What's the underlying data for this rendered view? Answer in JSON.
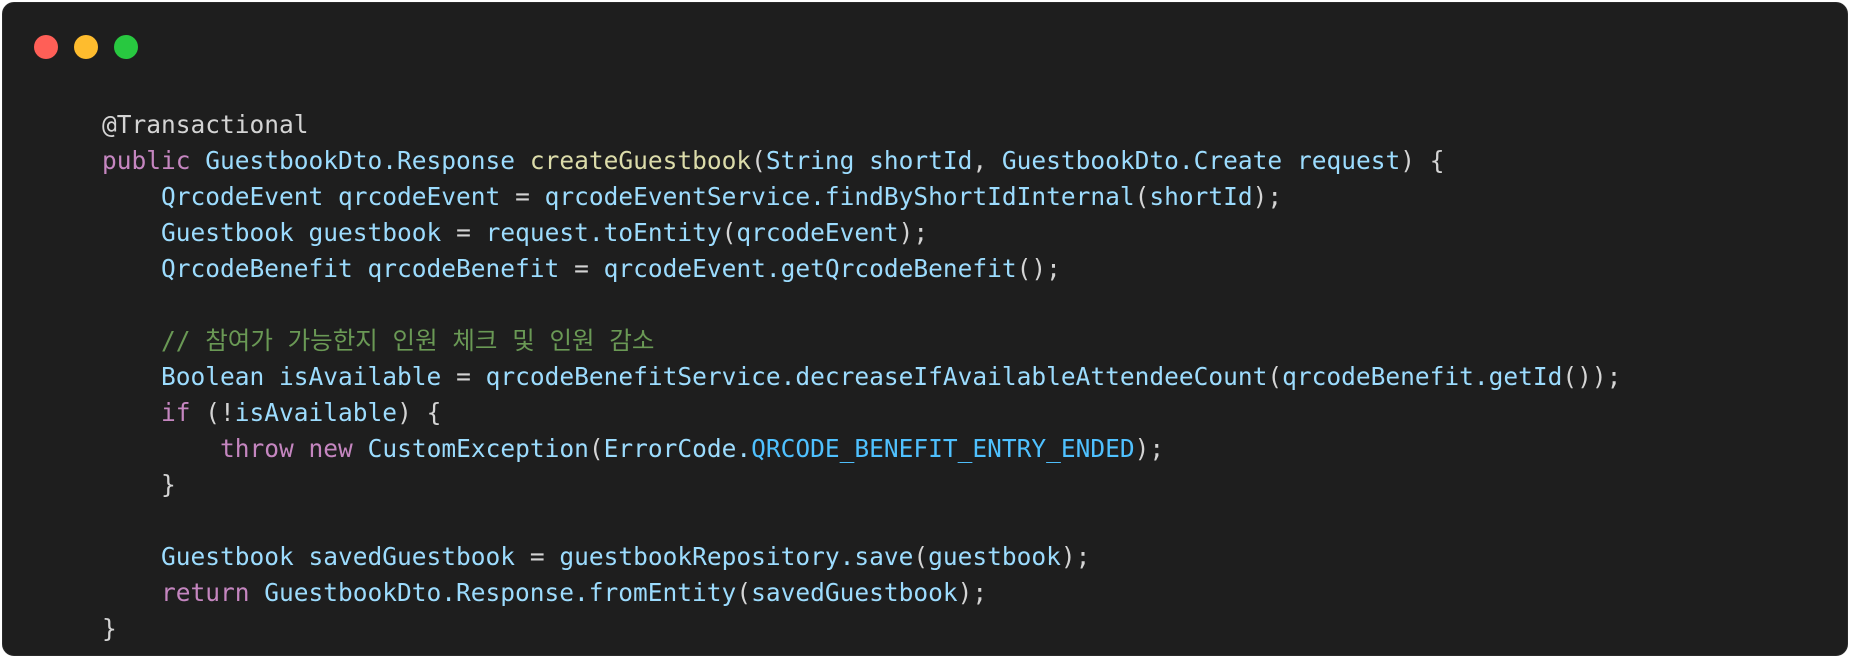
{
  "window": {
    "controls": [
      {
        "name": "close",
        "color": "#ff5f57"
      },
      {
        "name": "minimize",
        "color": "#febc2e"
      },
      {
        "name": "zoom",
        "color": "#28c840"
      }
    ]
  },
  "code": {
    "lines": [
      [
        {
          "t": "@Transactional",
          "c": "anno"
        }
      ],
      [
        {
          "t": "public",
          "c": "kw"
        },
        {
          "t": " ",
          "c": "punc"
        },
        {
          "t": "GuestbookDto.Response",
          "c": "type"
        },
        {
          "t": " ",
          "c": "punc"
        },
        {
          "t": "createGuestbook",
          "c": "fn"
        },
        {
          "t": "(",
          "c": "punc"
        },
        {
          "t": "String",
          "c": "type"
        },
        {
          "t": " ",
          "c": "punc"
        },
        {
          "t": "shortId",
          "c": "var"
        },
        {
          "t": ", ",
          "c": "punc"
        },
        {
          "t": "GuestbookDto.Create",
          "c": "type"
        },
        {
          "t": " ",
          "c": "punc"
        },
        {
          "t": "request",
          "c": "var"
        },
        {
          "t": ") {",
          "c": "punc"
        }
      ],
      [
        {
          "t": "    ",
          "c": "punc"
        },
        {
          "t": "QrcodeEvent",
          "c": "type"
        },
        {
          "t": " ",
          "c": "punc"
        },
        {
          "t": "qrcodeEvent",
          "c": "var"
        },
        {
          "t": " = ",
          "c": "punc"
        },
        {
          "t": "qrcodeEventService.findByShortIdInternal",
          "c": "call"
        },
        {
          "t": "(",
          "c": "punc"
        },
        {
          "t": "shortId",
          "c": "var"
        },
        {
          "t": ");",
          "c": "punc"
        }
      ],
      [
        {
          "t": "    ",
          "c": "punc"
        },
        {
          "t": "Guestbook",
          "c": "type"
        },
        {
          "t": " ",
          "c": "punc"
        },
        {
          "t": "guestbook",
          "c": "var"
        },
        {
          "t": " = ",
          "c": "punc"
        },
        {
          "t": "request.toEntity",
          "c": "call"
        },
        {
          "t": "(",
          "c": "punc"
        },
        {
          "t": "qrcodeEvent",
          "c": "var"
        },
        {
          "t": ");",
          "c": "punc"
        }
      ],
      [
        {
          "t": "    ",
          "c": "punc"
        },
        {
          "t": "QrcodeBenefit",
          "c": "type"
        },
        {
          "t": " ",
          "c": "punc"
        },
        {
          "t": "qrcodeBenefit",
          "c": "var"
        },
        {
          "t": " = ",
          "c": "punc"
        },
        {
          "t": "qrcodeEvent.getQrcodeBenefit",
          "c": "call"
        },
        {
          "t": "();",
          "c": "punc"
        }
      ],
      [],
      [
        {
          "t": "    ",
          "c": "punc"
        },
        {
          "t": "// 참여가 가능한지 인원 체크 및 인원 감소",
          "c": "com"
        }
      ],
      [
        {
          "t": "    ",
          "c": "punc"
        },
        {
          "t": "Boolean",
          "c": "type"
        },
        {
          "t": " ",
          "c": "punc"
        },
        {
          "t": "isAvailable",
          "c": "var"
        },
        {
          "t": " = ",
          "c": "punc"
        },
        {
          "t": "qrcodeBenefitService.decreaseIfAvailableAttendeeCount",
          "c": "call"
        },
        {
          "t": "(",
          "c": "punc"
        },
        {
          "t": "qrcodeBenefit.getId",
          "c": "call"
        },
        {
          "t": "());",
          "c": "punc"
        }
      ],
      [
        {
          "t": "    ",
          "c": "punc"
        },
        {
          "t": "if",
          "c": "kw"
        },
        {
          "t": " (!",
          "c": "punc"
        },
        {
          "t": "isAvailable",
          "c": "var"
        },
        {
          "t": ") {",
          "c": "punc"
        }
      ],
      [
        {
          "t": "        ",
          "c": "punc"
        },
        {
          "t": "throw",
          "c": "kw"
        },
        {
          "t": " ",
          "c": "punc"
        },
        {
          "t": "new",
          "c": "kw"
        },
        {
          "t": " ",
          "c": "punc"
        },
        {
          "t": "CustomException",
          "c": "type"
        },
        {
          "t": "(",
          "c": "punc"
        },
        {
          "t": "ErrorCode.",
          "c": "type"
        },
        {
          "t": "QRCODE_BENEFIT_ENTRY_ENDED",
          "c": "const"
        },
        {
          "t": ");",
          "c": "punc"
        }
      ],
      [
        {
          "t": "    }",
          "c": "punc"
        }
      ],
      [],
      [
        {
          "t": "    ",
          "c": "punc"
        },
        {
          "t": "Guestbook",
          "c": "type"
        },
        {
          "t": " ",
          "c": "punc"
        },
        {
          "t": "savedGuestbook",
          "c": "var"
        },
        {
          "t": " = ",
          "c": "punc"
        },
        {
          "t": "guestbookRepository.save",
          "c": "call"
        },
        {
          "t": "(",
          "c": "punc"
        },
        {
          "t": "guestbook",
          "c": "var"
        },
        {
          "t": ");",
          "c": "punc"
        }
      ],
      [
        {
          "t": "    ",
          "c": "punc"
        },
        {
          "t": "return",
          "c": "kw"
        },
        {
          "t": " ",
          "c": "punc"
        },
        {
          "t": "GuestbookDto.Response.fromEntity",
          "c": "call"
        },
        {
          "t": "(",
          "c": "punc"
        },
        {
          "t": "savedGuestbook",
          "c": "var"
        },
        {
          "t": ");",
          "c": "punc"
        }
      ],
      [
        {
          "t": "}",
          "c": "punc"
        }
      ]
    ]
  }
}
